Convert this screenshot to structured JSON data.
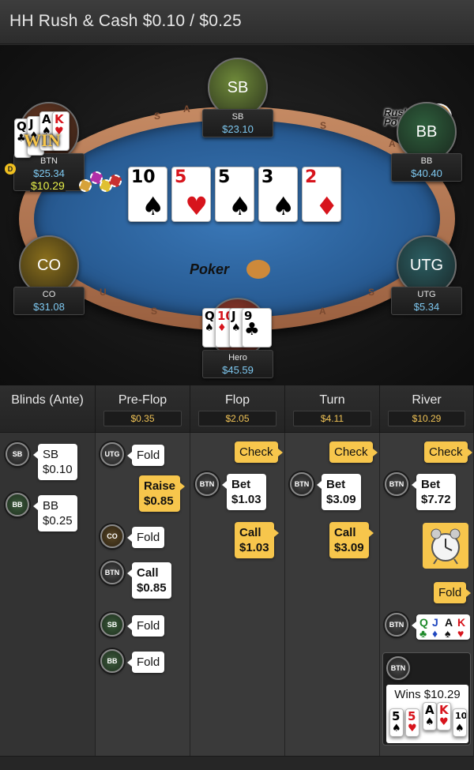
{
  "header": {
    "title": "HH  Rush & Cash $0.10 / $0.25"
  },
  "table": {
    "rail_text": [
      "S",
      "A",
      "S",
      "A",
      "S",
      "U",
      "A",
      "S"
    ],
    "logo_text": "Rush&Cash\nPoker",
    "felt_logo_text": "Poker",
    "board": [
      {
        "rank": "10",
        "suit": "♠",
        "color": "black"
      },
      {
        "rank": "5",
        "suit": "♥",
        "color": "red"
      },
      {
        "rank": "5",
        "suit": "♠",
        "color": "black"
      },
      {
        "rank": "3",
        "suit": "♠",
        "color": "black"
      },
      {
        "rank": "2",
        "suit": "♦",
        "color": "red"
      }
    ],
    "seats": [
      {
        "id": "sb",
        "avatar": "SB",
        "name": "SB",
        "stack": "$23.10",
        "color": "#6f8a3a"
      },
      {
        "id": "bb",
        "avatar": "BB",
        "name": "BB",
        "stack": "$40.40",
        "color": "#2e5e3c"
      },
      {
        "id": "utg",
        "avatar": "UTG",
        "name": "UTG",
        "stack": "$5.34",
        "color": "#2c5e62"
      },
      {
        "id": "hero",
        "avatar": "",
        "name": "Hero",
        "stack": "$45.59",
        "color": "#9c3a2c"
      },
      {
        "id": "co",
        "avatar": "CO",
        "name": "CO",
        "stack": "$31.08",
        "color": "#8a6f1c"
      },
      {
        "id": "btn",
        "avatar": "",
        "name": "BTN",
        "stack": "$25.34",
        "color": "#6e3a22"
      }
    ],
    "btn_win": "$10.29",
    "btn_win_label": "WIN",
    "dealer_button": "D",
    "btn_cards": [
      {
        "rank": "Q",
        "suit": "♣",
        "color": "black"
      },
      {
        "rank": "J",
        "suit": "♦",
        "color": "black"
      },
      {
        "rank": "A",
        "suit": "♠",
        "color": "black"
      },
      {
        "rank": "K",
        "suit": "♥",
        "color": "red"
      }
    ],
    "hero_cards": [
      {
        "rank": "Q",
        "suit": "♠",
        "color": "black"
      },
      {
        "rank": "10",
        "suit": "♦",
        "color": "red"
      },
      {
        "rank": "J",
        "suit": "♠",
        "color": "black"
      },
      {
        "rank": "9",
        "suit": "♣",
        "color": "black"
      }
    ]
  },
  "hand_history": {
    "columns": [
      {
        "name": "Blinds (Ante)",
        "pot": ""
      },
      {
        "name": "Pre-Flop",
        "pot": "$0.35"
      },
      {
        "name": "Flop",
        "pot": "$2.05"
      },
      {
        "name": "Turn",
        "pot": "$4.11"
      },
      {
        "name": "River",
        "pot": "$10.29"
      }
    ],
    "blinds": [
      {
        "pos": "SB",
        "line1": "SB",
        "line2": "$0.10"
      },
      {
        "pos": "BB",
        "line1": "BB",
        "line2": "$0.25"
      }
    ],
    "preflop": [
      {
        "pos": "UTG",
        "action": "Fold"
      },
      {
        "pos": "",
        "action": "Raise",
        "amount": "$0.85"
      },
      {
        "pos": "CO",
        "action": "Fold"
      },
      {
        "pos": "BTN",
        "action": "Call",
        "amount": "$0.85"
      },
      {
        "pos": "SB",
        "action": "Fold"
      },
      {
        "pos": "BB",
        "action": "Fold"
      }
    ],
    "flop": [
      {
        "action": "Check"
      },
      {
        "pos": "BTN",
        "action": "Bet",
        "amount": "$1.03"
      },
      {
        "action": "Call",
        "amount": "$1.03"
      }
    ],
    "turn": [
      {
        "action": "Check"
      },
      {
        "pos": "BTN",
        "action": "Bet",
        "amount": "$3.09"
      },
      {
        "action": "Call",
        "amount": "$3.09"
      }
    ],
    "river": [
      {
        "action": "Check"
      },
      {
        "pos": "BTN",
        "action": "Bet",
        "amount": "$7.72"
      },
      {
        "action": "Fold"
      }
    ],
    "river_show": {
      "pos": "BTN",
      "cards": [
        {
          "rank": "Q",
          "suit": "♣",
          "color": "green"
        },
        {
          "rank": "J",
          "suit": "♦",
          "color": "blue"
        },
        {
          "rank": "A",
          "suit": "♠",
          "color": "black"
        },
        {
          "rank": "K",
          "suit": "♥",
          "color": "red"
        }
      ]
    },
    "winner": {
      "pos": "BTN",
      "text": "Wins $10.29",
      "cards": [
        {
          "rank": "5",
          "suit": "♠",
          "color": "black"
        },
        {
          "rank": "5",
          "suit": "♥",
          "color": "red"
        },
        {
          "rank": "A",
          "suit": "♠",
          "color": "black"
        },
        {
          "rank": "K",
          "suit": "♥",
          "color": "red"
        },
        {
          "rank": "10",
          "suit": "♠",
          "color": "black"
        }
      ]
    }
  }
}
